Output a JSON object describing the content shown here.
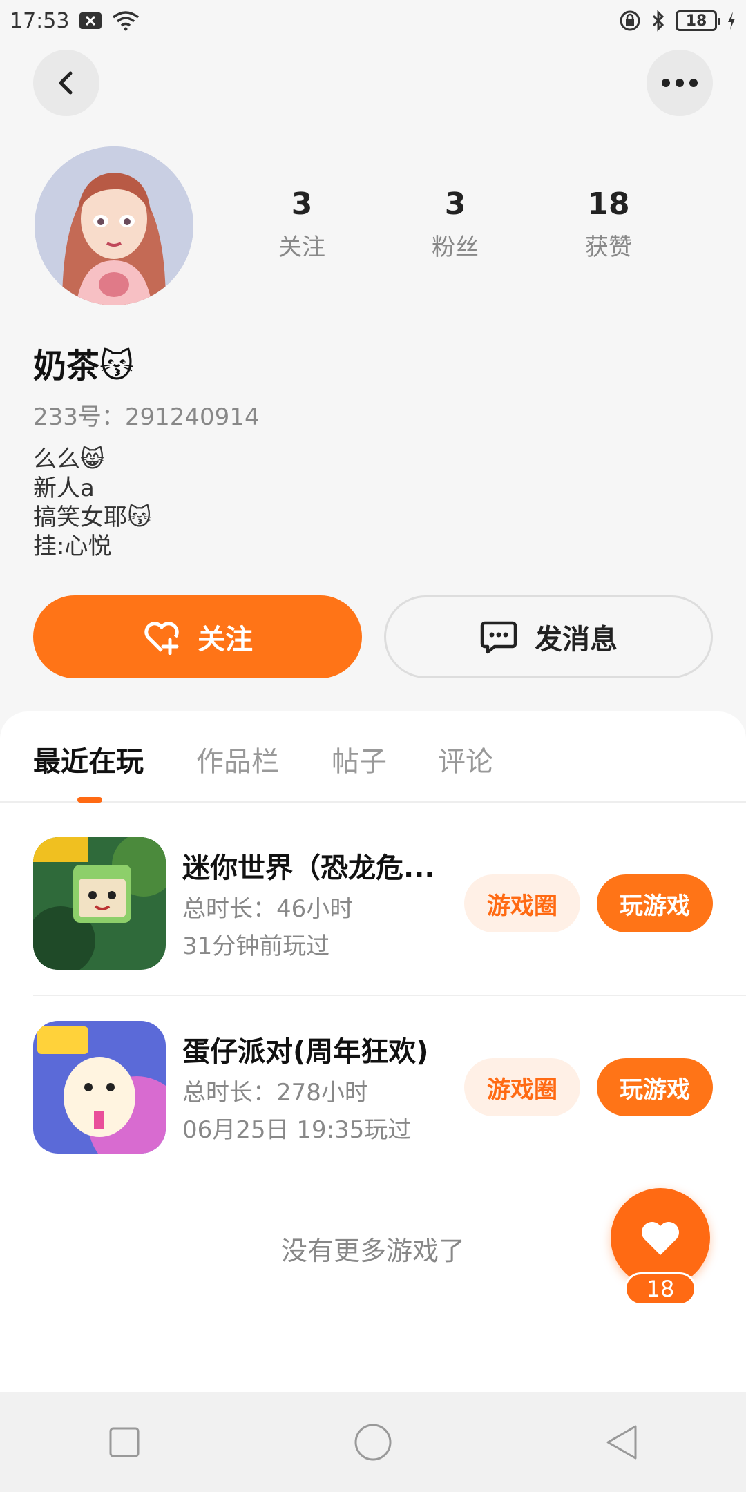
{
  "status_bar": {
    "time": "17:53",
    "battery": "18",
    "icons": [
      "notification-x-icon",
      "wifi-icon",
      "lock-rotation-icon",
      "bluetooth-icon",
      "battery-icon",
      "charging-icon"
    ]
  },
  "profile": {
    "stats": [
      {
        "value": "3",
        "label": "关注"
      },
      {
        "value": "3",
        "label": "粉丝"
      },
      {
        "value": "18",
        "label": "获赞"
      }
    ],
    "username": "奶茶😽",
    "user_id": "233号：291240914",
    "bio_lines": [
      "么么😸",
      "新人a",
      "搞笑女耶😽",
      "挂:心悦"
    ]
  },
  "actions": {
    "follow_label": "关注",
    "message_label": "发消息"
  },
  "tabs": [
    {
      "label": "最近在玩",
      "active": true
    },
    {
      "label": "作品栏",
      "active": false
    },
    {
      "label": "帖子",
      "active": false
    },
    {
      "label": "评论",
      "active": false
    }
  ],
  "games": [
    {
      "title": "迷你世界（恐龙危...",
      "playtime": "总时长：46小时",
      "last_played": "31分钟前玩过",
      "community_label": "游戏圈",
      "play_label": "玩游戏"
    },
    {
      "title": "蛋仔派对(周年狂欢)",
      "playtime": "总时长：278小时",
      "last_played": "06月25日 19:35玩过",
      "community_label": "游戏圈",
      "play_label": "玩游戏"
    }
  ],
  "no_more_text": "没有更多游戏了",
  "like_count": "18",
  "colors": {
    "accent": "#ff7417",
    "accent_light": "#fff0e6",
    "background": "#f6f6f6"
  }
}
